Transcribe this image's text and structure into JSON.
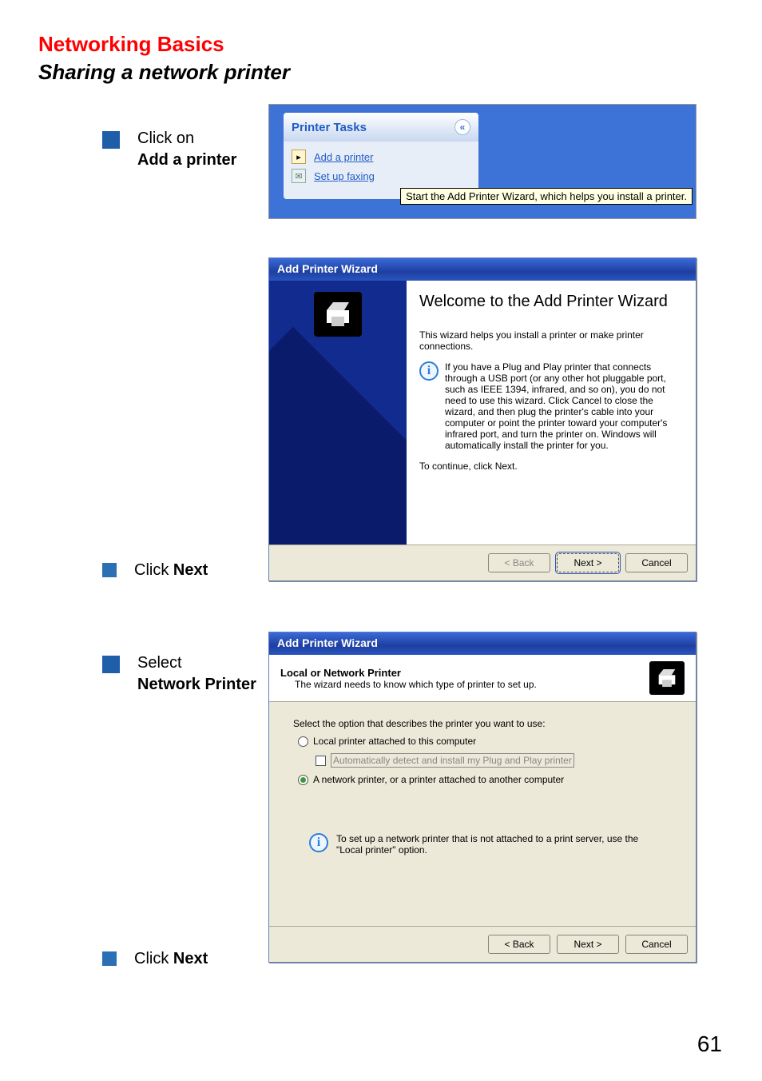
{
  "page": {
    "title_red": "Networking Basics",
    "title_sub": "Sharing a network printer",
    "number": "61"
  },
  "bullets": {
    "b1_pre": "Click on ",
    "b1_bold": "Add a printer",
    "b2_pre": "Click ",
    "b2_bold": "Next",
    "b3_pre": "Select",
    "b3_bold": "Network Printer",
    "b4_pre": "Click ",
    "b4_bold": "Next"
  },
  "tasks": {
    "header": "Printer Tasks",
    "collapse_glyph": "«",
    "link_add": "Add a printer",
    "link_fax": "Set up faxing",
    "tooltip": "Start the Add Printer Wizard, which helps you install a printer."
  },
  "wizard1": {
    "titlebar": "Add Printer Wizard",
    "heading": "Welcome to the Add Printer Wizard",
    "body1": "This wizard helps you install a printer or make printer connections.",
    "info": "If you have a Plug and Play printer that connects through a USB port (or any other hot pluggable port, such as IEEE 1394, infrared, and so on), you do not need to use this wizard. Click Cancel to close the wizard, and then plug the printer's cable into your computer or point the printer toward your computer's infrared port, and turn the printer on. Windows will automatically install the printer for you.",
    "body2": "To continue, click Next.",
    "back": "< Back",
    "next": "Next >",
    "cancel": "Cancel"
  },
  "wizard2": {
    "titlebar": "Add Printer Wizard",
    "head_bold": "Local or Network Printer",
    "head_sub": "The wizard needs to know which type of printer to set up.",
    "prompt": "Select the option that describes the printer you want to use:",
    "opt_local": "Local printer attached to this computer",
    "opt_auto": "Automatically detect and install my Plug and Play printer",
    "opt_network": "A network printer, or a printer attached to another computer",
    "info": "To set up a network printer that is not attached to a print server, use the \"Local printer\" option.",
    "back": "< Back",
    "next": "Next >",
    "cancel": "Cancel"
  }
}
